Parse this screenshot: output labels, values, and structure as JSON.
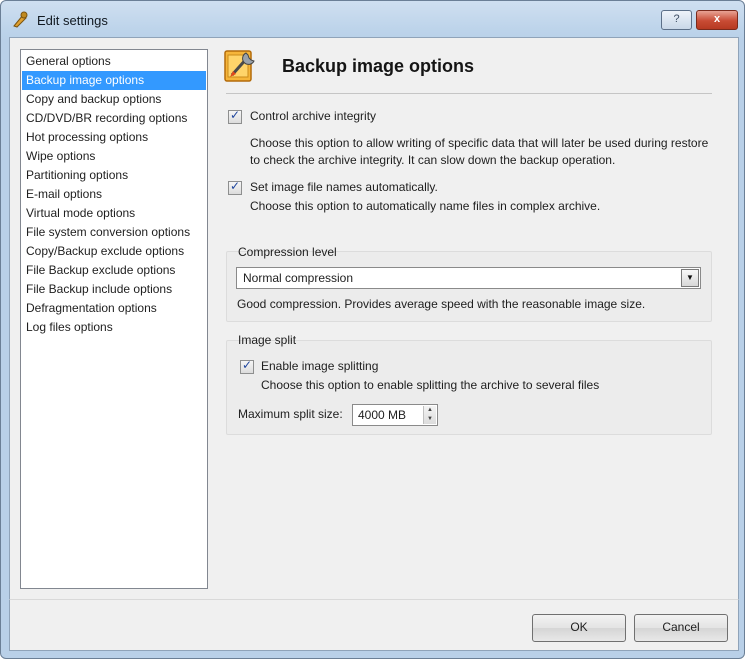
{
  "window": {
    "title": "Edit settings",
    "help_label": "?",
    "close_label": "x"
  },
  "nav": {
    "items": [
      {
        "label": "General options"
      },
      {
        "label": "Backup image options",
        "selected": true
      },
      {
        "label": "Copy and backup options"
      },
      {
        "label": "CD/DVD/BR recording options"
      },
      {
        "label": "Hot processing options"
      },
      {
        "label": "Wipe options"
      },
      {
        "label": "Partitioning options"
      },
      {
        "label": "E-mail options"
      },
      {
        "label": "Virtual mode options"
      },
      {
        "label": "File system conversion options"
      },
      {
        "label": "Copy/Backup exclude options"
      },
      {
        "label": "File Backup exclude options"
      },
      {
        "label": "File Backup include options"
      },
      {
        "label": "Defragmentation options"
      },
      {
        "label": "Log files options"
      }
    ]
  },
  "page": {
    "title": "Backup image options",
    "icon": "settings-tools-icon",
    "options": {
      "integrity": {
        "label": "Control archive integrity",
        "checked": true,
        "description": "Choose this option to allow writing of specific data that will later be used during restore to check the archive integrity. It can slow down the backup operation."
      },
      "auto_names": {
        "label": "Set image file names automatically.",
        "checked": true,
        "description": "Choose this option to automatically name files in complex archive."
      }
    },
    "compression": {
      "group_title": "Compression level",
      "selected": "Normal compression",
      "description": "Good compression. Provides average speed with the reasonable image size."
    },
    "split": {
      "group_title": "Image split",
      "enable_label": "Enable image splitting",
      "enabled": true,
      "description": "Choose this option to enable splitting the archive to several files",
      "max_size_label": "Maximum split size:",
      "max_size_value": "4000 MB"
    }
  },
  "buttons": {
    "ok": "OK",
    "cancel": "Cancel"
  }
}
